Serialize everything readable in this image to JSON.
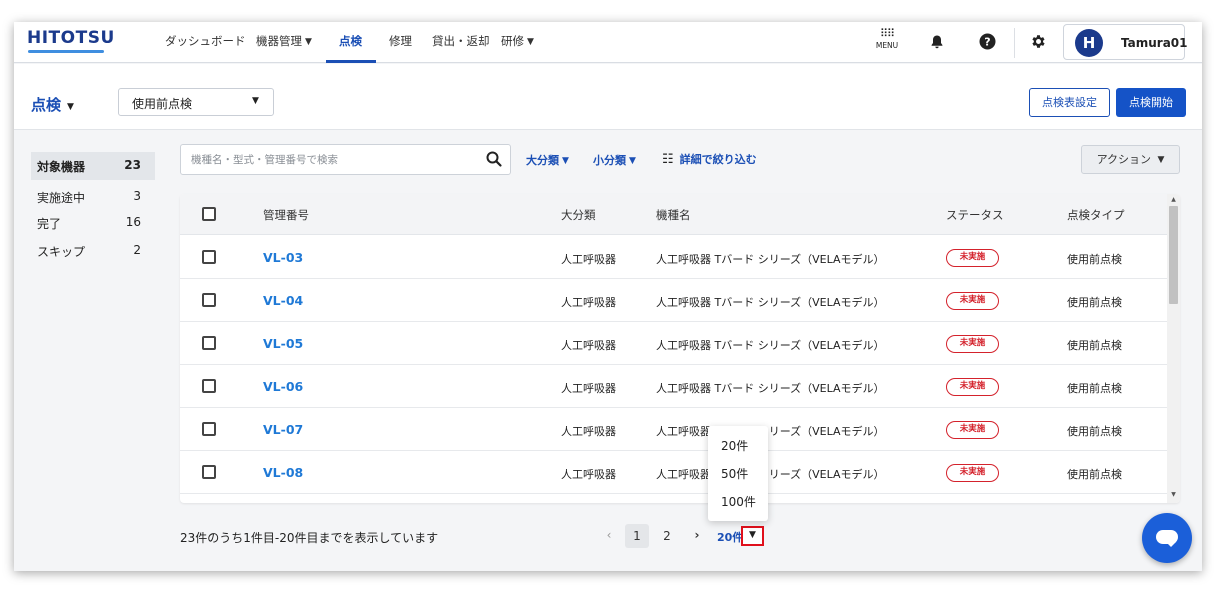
{
  "brand": {
    "logo": "HITOTSU"
  },
  "nav": {
    "items": [
      {
        "label": "ダッシュボード"
      },
      {
        "label": "機器管理"
      },
      {
        "label": "点検"
      },
      {
        "label": "修理"
      },
      {
        "label": "貸出・返却"
      },
      {
        "label": "研修"
      }
    ],
    "menu_label": "MENU",
    "user_initial": "H",
    "username": "Tamura01"
  },
  "subheader": {
    "title": "点検",
    "select_value": "使用前点検",
    "settings_button": "点検表設定",
    "start_button": "点検開始"
  },
  "summary": [
    {
      "label": "対象機器",
      "count": "23"
    },
    {
      "label": "実施途中",
      "count": "3"
    },
    {
      "label": "完了",
      "count": "16"
    },
    {
      "label": "スキップ",
      "count": "2"
    }
  ],
  "toolbar": {
    "search_placeholder": "機種名・型式・管理番号で検索",
    "major_filter": "大分類",
    "minor_filter": "小分類",
    "detail_filter": "詳細で絞り込む",
    "action_button": "アクション"
  },
  "table": {
    "headers": {
      "id": "管理番号",
      "category": "大分類",
      "model": "機種名",
      "status": "ステータス",
      "type": "点検タイプ"
    },
    "rows": [
      {
        "id": "VL-03",
        "category": "人工呼吸器",
        "model": "人工呼吸器 Tバード シリーズ（VELAモデル）",
        "status": "未実施",
        "type": "使用前点検"
      },
      {
        "id": "VL-04",
        "category": "人工呼吸器",
        "model": "人工呼吸器 Tバード シリーズ（VELAモデル）",
        "status": "未実施",
        "type": "使用前点検"
      },
      {
        "id": "VL-05",
        "category": "人工呼吸器",
        "model": "人工呼吸器 Tバード シリーズ（VELAモデル）",
        "status": "未実施",
        "type": "使用前点検"
      },
      {
        "id": "VL-06",
        "category": "人工呼吸器",
        "model": "人工呼吸器 Tバード シリーズ（VELAモデル）",
        "status": "未実施",
        "type": "使用前点検"
      },
      {
        "id": "VL-07",
        "category": "人工呼吸器",
        "model": "人工呼吸器 Tバード シリーズ（VELAモデル）",
        "status": "未実施",
        "type": "使用前点検"
      },
      {
        "id": "VL-08",
        "category": "人工呼吸器",
        "model": "人工呼吸器 Tバード シリーズ（VELAモデル）",
        "status": "未実施",
        "type": "使用前点検"
      }
    ]
  },
  "footer": {
    "summary_text": "23件のうち1件目-20件目までを表示しています",
    "pages": [
      "1",
      "2"
    ],
    "per_page": "20件",
    "per_page_options": [
      "20件",
      "50件",
      "100件"
    ]
  },
  "colors": {
    "brand": "#1b3a8c",
    "accent": "#1b4fb5",
    "link": "#1f79d6",
    "status_red": "#d4222c",
    "primary_button": "#1553c7"
  },
  "icons": [
    "menu-grid-icon",
    "bell-icon",
    "help-icon",
    "gear-icon",
    "search-icon",
    "tune-icon",
    "chat-icon"
  ]
}
